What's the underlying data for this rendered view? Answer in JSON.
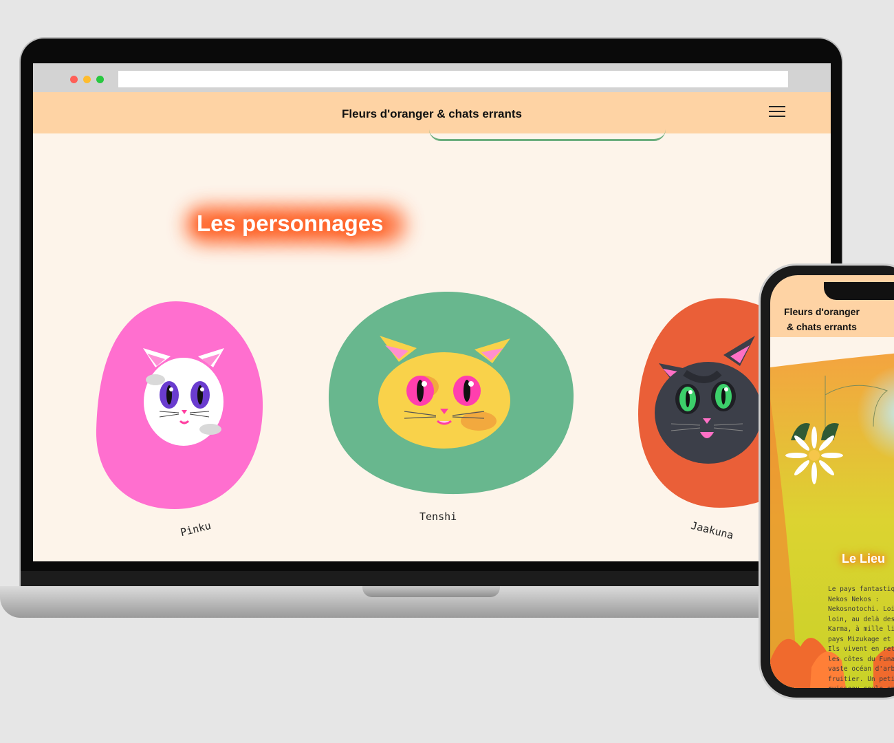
{
  "desktop": {
    "browser": {
      "window_controls": [
        "close",
        "minimize",
        "maximize"
      ],
      "colors": {
        "close": "#ff5f57",
        "minimize": "#febc2e",
        "maximize": "#28c840"
      }
    },
    "header": {
      "title": "Fleurs d'oranger & chats errants",
      "menu_icon": "hamburger-menu-icon",
      "background": "#fed3a4"
    },
    "section": {
      "title": "Les personnages"
    },
    "characters": [
      {
        "name": "Pinku",
        "blob_color": "#ff6fcf"
      },
      {
        "name": "Tenshi",
        "blob_color": "#68b78e"
      },
      {
        "name": "Jaakuna",
        "blob_color": "#ea5f38"
      }
    ],
    "background": "#fdf4ea"
  },
  "mobile": {
    "header": {
      "title_line1": "Fleurs d'oranger",
      "title_line2": "& chats errants"
    },
    "section": {
      "title": "Le Lieu",
      "text": "Le pays fantastiq\nNekos Nekos :\nNekosnotochi. Loin\nloin, au delà des\nKarma, à mille li\npays Mizukage et\nIls vivent en ret\nles côtes du Funa\nvaste océan d'arb\nfruitier. Un peti\nruisseau coule en\nlieu et les appro\nen réglalades néc\nen tout genre; un\nparadisiaque..."
    }
  }
}
